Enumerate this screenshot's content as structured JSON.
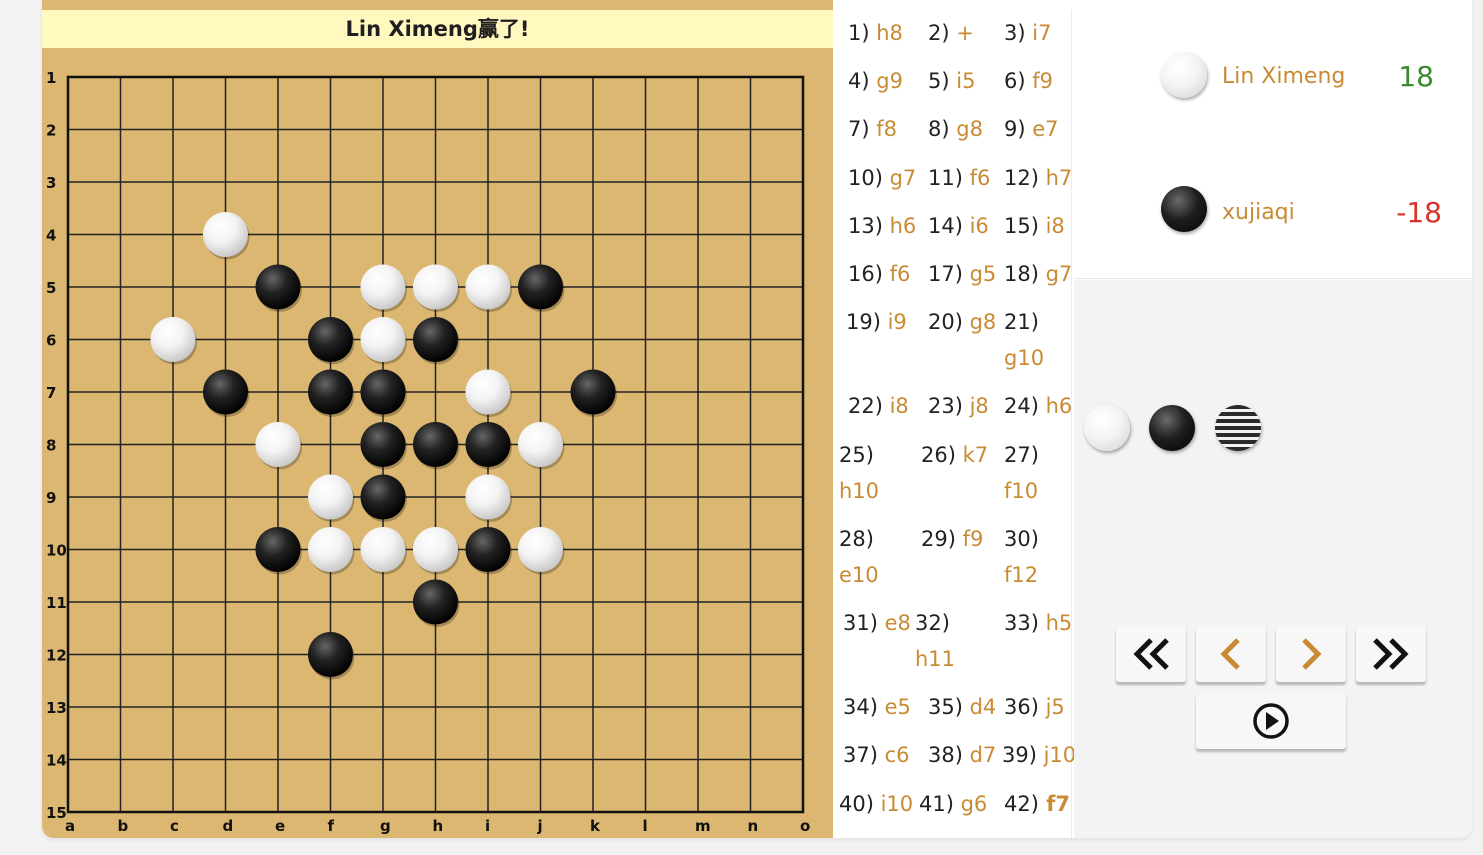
{
  "status": {
    "message": "Lin Ximeng赢了!"
  },
  "board": {
    "size": 15,
    "columns": [
      "a",
      "b",
      "c",
      "d",
      "e",
      "f",
      "g",
      "h",
      "i",
      "j",
      "k",
      "l",
      "m",
      "n",
      "o"
    ],
    "rows": [
      "1",
      "2",
      "3",
      "4",
      "5",
      "6",
      "7",
      "8",
      "9",
      "10",
      "11",
      "12",
      "13",
      "14",
      "15"
    ],
    "stones": [
      {
        "coord": "d4",
        "color": "white"
      },
      {
        "coord": "e5",
        "color": "black"
      },
      {
        "coord": "g5",
        "color": "white"
      },
      {
        "coord": "h5",
        "color": "white"
      },
      {
        "coord": "i5",
        "color": "white"
      },
      {
        "coord": "j5",
        "color": "black"
      },
      {
        "coord": "c6",
        "color": "white"
      },
      {
        "coord": "f6",
        "color": "black"
      },
      {
        "coord": "g6",
        "color": "white"
      },
      {
        "coord": "h6",
        "color": "black"
      },
      {
        "coord": "d7",
        "color": "black"
      },
      {
        "coord": "f7",
        "color": "black"
      },
      {
        "coord": "g7",
        "color": "black"
      },
      {
        "coord": "i7",
        "color": "white"
      },
      {
        "coord": "k7",
        "color": "black"
      },
      {
        "coord": "e8",
        "color": "white"
      },
      {
        "coord": "g8",
        "color": "black"
      },
      {
        "coord": "h8",
        "color": "black"
      },
      {
        "coord": "i8",
        "color": "black"
      },
      {
        "coord": "j8",
        "color": "white"
      },
      {
        "coord": "f9",
        "color": "white"
      },
      {
        "coord": "g9",
        "color": "black"
      },
      {
        "coord": "i9",
        "color": "white"
      },
      {
        "coord": "e10",
        "color": "black"
      },
      {
        "coord": "f10",
        "color": "white"
      },
      {
        "coord": "g10",
        "color": "white"
      },
      {
        "coord": "h10",
        "color": "white"
      },
      {
        "coord": "i10",
        "color": "black"
      },
      {
        "coord": "j10",
        "color": "white"
      },
      {
        "coord": "h11",
        "color": "black"
      },
      {
        "coord": "f12",
        "color": "black"
      }
    ]
  },
  "moves": [
    {
      "num": "1)",
      "coord": "h8"
    },
    {
      "num": "2)",
      "coord": "+"
    },
    {
      "num": "3)",
      "coord": "i7"
    },
    {
      "num": "4)",
      "coord": "g9"
    },
    {
      "num": "5)",
      "coord": "i5"
    },
    {
      "num": "6)",
      "coord": "f9"
    },
    {
      "num": "7)",
      "coord": "f8"
    },
    {
      "num": "8)",
      "coord": "g8"
    },
    {
      "num": "9)",
      "coord": "e7"
    },
    {
      "num": "10)",
      "coord": "g7"
    },
    {
      "num": "11)",
      "coord": "f6"
    },
    {
      "num": "12)",
      "coord": "h7"
    },
    {
      "num": "13)",
      "coord": "h6"
    },
    {
      "num": "14)",
      "coord": "i6"
    },
    {
      "num": "15)",
      "coord": "i8"
    },
    {
      "num": "16)",
      "coord": "f6"
    },
    {
      "num": "17)",
      "coord": "g5"
    },
    {
      "num": "18)",
      "coord": "g7"
    },
    {
      "num": "19)",
      "coord": "i9"
    },
    {
      "num": "20)",
      "coord": "g8"
    },
    {
      "num": "21)",
      "coord": "g10"
    },
    {
      "num": "22)",
      "coord": "i8"
    },
    {
      "num": "23)",
      "coord": "j8"
    },
    {
      "num": "24)",
      "coord": "h6"
    },
    {
      "num": "25)",
      "coord": "h10"
    },
    {
      "num": "26)",
      "coord": "k7"
    },
    {
      "num": "27)",
      "coord": "f10"
    },
    {
      "num": "28)",
      "coord": "e10"
    },
    {
      "num": "29)",
      "coord": "f9"
    },
    {
      "num": "30)",
      "coord": "f12"
    },
    {
      "num": "31)",
      "coord": "e8"
    },
    {
      "num": "32)",
      "coord": "h11"
    },
    {
      "num": "33)",
      "coord": "h5"
    },
    {
      "num": "34)",
      "coord": "e5"
    },
    {
      "num": "35)",
      "coord": "d4"
    },
    {
      "num": "36)",
      "coord": "j5"
    },
    {
      "num": "37)",
      "coord": "c6"
    },
    {
      "num": "38)",
      "coord": "d7"
    },
    {
      "num": "39)",
      "coord": "j10"
    },
    {
      "num": "40)",
      "coord": "i10"
    },
    {
      "num": "41)",
      "coord": "g6"
    },
    {
      "num": "42)",
      "coord": "f7"
    }
  ],
  "players": [
    {
      "name": "Lin Ximeng",
      "stone": "white",
      "score": "18",
      "score_color": "#3a8a2e"
    },
    {
      "name": "xujiaqi",
      "stone": "black",
      "score": "-18",
      "score_color": "#d9342b"
    }
  ],
  "controls": {
    "stone_choices": [
      "white-stone-icon",
      "black-stone-icon",
      "striped-stone-icon"
    ],
    "buttons": [
      "first-move-button",
      "previous-move-button",
      "next-move-button",
      "last-move-button",
      "autoplay-button"
    ],
    "accent": "#c98a34"
  }
}
